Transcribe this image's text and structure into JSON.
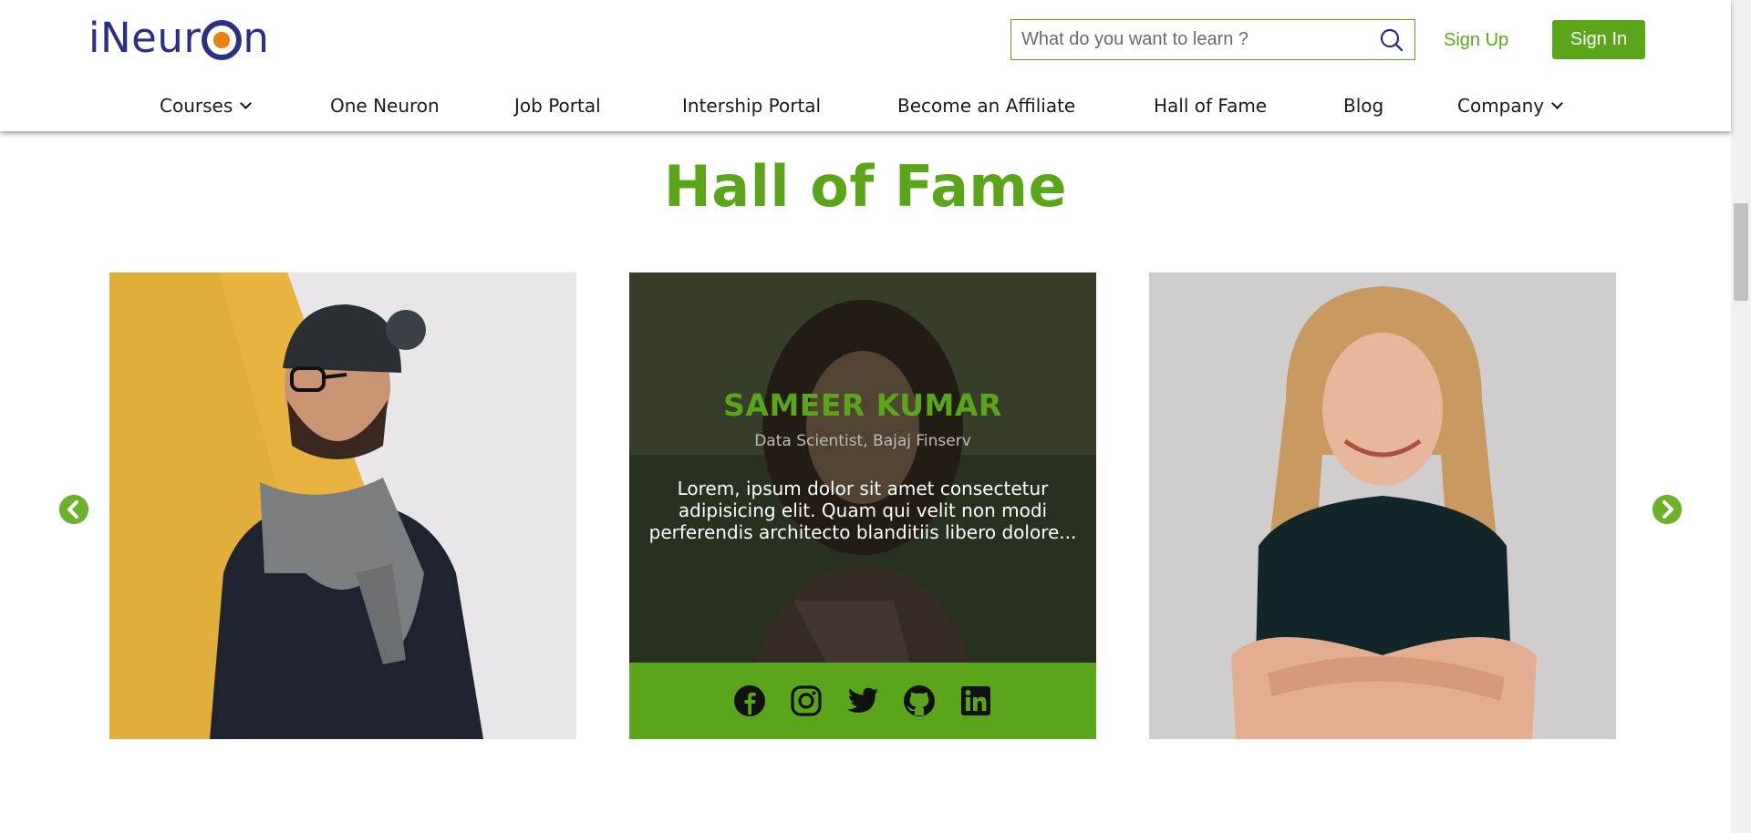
{
  "brand": {
    "logo_text_before": "iNeur",
    "logo_text_after": "n"
  },
  "search": {
    "placeholder": "What do you want to learn ?",
    "icon": "search-icon"
  },
  "auth": {
    "signup_label": "Sign Up",
    "signin_label": "Sign In"
  },
  "nav": {
    "items": [
      {
        "label": "Courses",
        "has_dropdown": true
      },
      {
        "label": "One Neuron"
      },
      {
        "label": "Job Portal"
      },
      {
        "label": "Intership Portal"
      },
      {
        "label": "Become an Affiliate"
      },
      {
        "label": "Hall of Fame"
      },
      {
        "label": "Blog"
      },
      {
        "label": "Company",
        "has_dropdown": true
      }
    ]
  },
  "section": {
    "title": "Hall of Fame"
  },
  "carousel": {
    "cards": [
      {
        "image": "man-with-beanie-photo"
      },
      {
        "image": "woman-portrait-photo",
        "name": "SAMEER KUMAR",
        "role": "Data Scientist, Bajaj Finserv",
        "description": "Lorem, ipsum dolor sit amet consectetur adipisicing elit. Quam qui velit non modi perferendis architecto blanditiis libero dolore...",
        "socials": [
          "facebook-icon",
          "instagram-icon",
          "twitter-icon",
          "github-icon",
          "linkedin-icon"
        ]
      },
      {
        "image": "blonde-woman-photo"
      }
    ],
    "prev_icon": "arrow-left-circle-icon",
    "next_icon": "arrow-right-circle-icon"
  },
  "colors": {
    "brand_green": "#5aa51a",
    "logo_blue": "#2b2f86",
    "logo_orange": "#e8820c"
  }
}
